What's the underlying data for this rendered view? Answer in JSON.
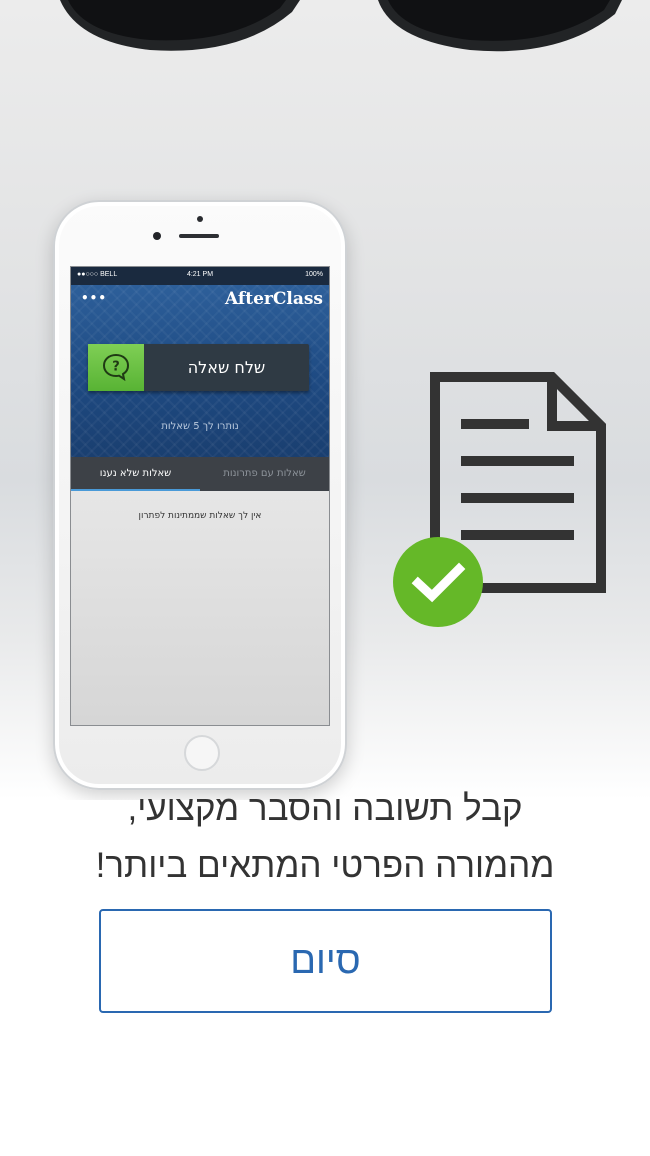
{
  "phone": {
    "status_bar": {
      "carrier": "●●○○○ BELL",
      "time": "4:21 PM",
      "battery": "100%"
    },
    "app": {
      "logo": "AfterClass",
      "menu_icon": "•••",
      "ask_button_label": "שלח שאלה",
      "remaining_questions": "נותרו לך 5 שאלות",
      "tabs": [
        {
          "label": "שאלות שלא נענו",
          "active": true
        },
        {
          "label": "שאלות עם פתרונות",
          "active": false
        }
      ],
      "empty_message": "אין לך שאלות שממתינות לפתרון"
    }
  },
  "illustration": {
    "icon": "document-icon",
    "badge_icon": "checkmark-icon",
    "badge_color": "#65b828"
  },
  "message": {
    "line1": "קבל תשובה והסבר מקצועי,",
    "line2": "מהמורה הפרטי המתאים ביותר!"
  },
  "finish_button": {
    "label": "סיום",
    "color": "#2a68b1"
  }
}
